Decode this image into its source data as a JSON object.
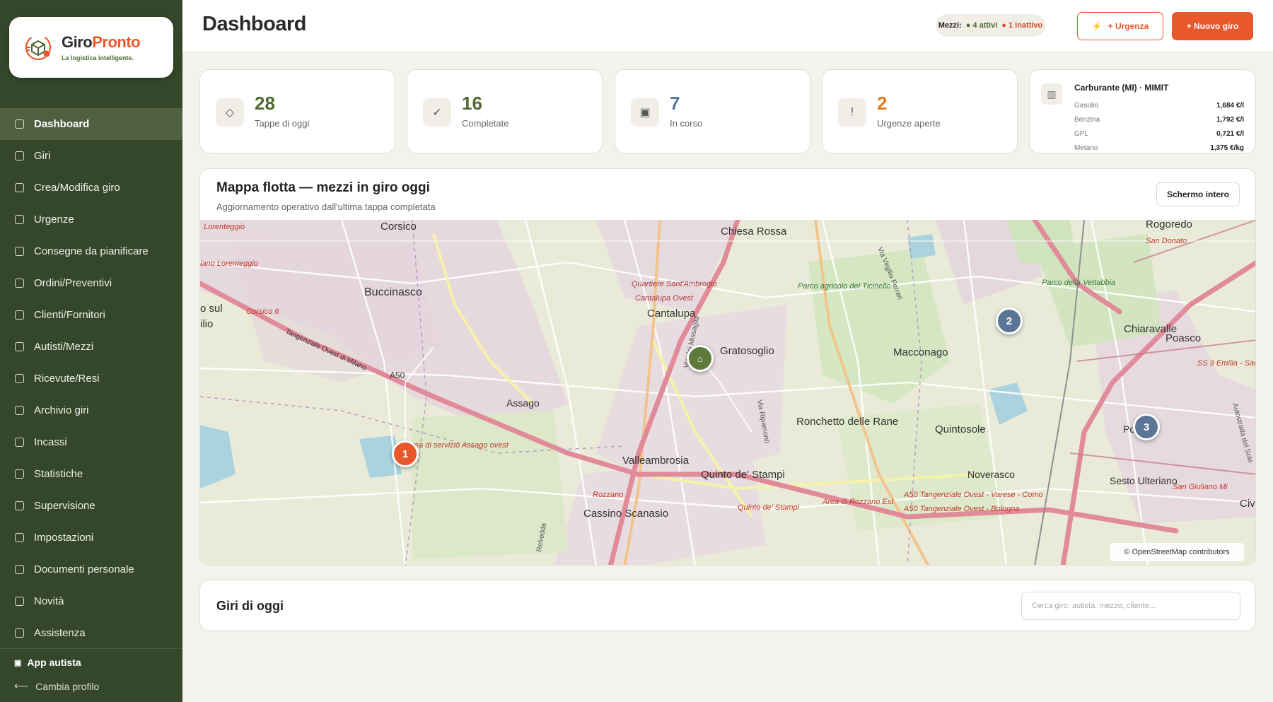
{
  "brand": {
    "name_part1": "Giro",
    "name_part2": "Pronto",
    "tagline": "La logistica intelligente."
  },
  "sidebar": {
    "items": [
      {
        "label": "Dashboard",
        "active": true
      },
      {
        "label": "Giri"
      },
      {
        "label": "Crea/Modifica giro"
      },
      {
        "label": "Urgenze"
      },
      {
        "label": "Consegne da pianificare"
      },
      {
        "label": "Ordini/Preventivi"
      },
      {
        "label": "Clienti/Fornitori"
      },
      {
        "label": "Autisti/Mezzi"
      },
      {
        "label": "Ricevute/Resi"
      },
      {
        "label": "Archivio giri"
      },
      {
        "label": "Incassi"
      },
      {
        "label": "Statistiche"
      },
      {
        "label": "Supervisione"
      },
      {
        "label": "Impostazioni"
      },
      {
        "label": "Documenti personale"
      },
      {
        "label": "Novità"
      },
      {
        "label": "Assistenza"
      }
    ],
    "app_driver": "App autista",
    "change_profile": "Cambia profilo"
  },
  "header": {
    "title": "Dashboard",
    "fleet_label": "Mezzi:",
    "fleet_active": "● 4 attivi",
    "fleet_inactive": "● 1 inattivo",
    "urgency_button": "+ Urgenza",
    "new_tour_button": "+ Nuovo giro"
  },
  "stats": [
    {
      "value": "28",
      "label": "Tappe di oggi",
      "icon": "◇",
      "color": "#4f6a31"
    },
    {
      "value": "16",
      "label": "Completate",
      "icon": "✓",
      "color": "#4f6a31"
    },
    {
      "value": "7",
      "label": "In corso",
      "icon": "▣",
      "color": "#5b78a0"
    },
    {
      "value": "2",
      "label": "Urgenze aperte",
      "icon": "!",
      "color": "#e07b1e"
    }
  ],
  "fuel": {
    "title": "Carburante (MI) · MIMIT",
    "rows": [
      {
        "name": "Gasolio",
        "price": "1,684 €/l"
      },
      {
        "name": "Benzina",
        "price": "1,792 €/l"
      },
      {
        "name": "GPL",
        "price": "0,721 €/l"
      },
      {
        "name": "Metano",
        "price": "1,375 €/kg"
      }
    ]
  },
  "map": {
    "title": "Mappa flotta — mezzi in giro oggi",
    "subtitle": "Aggiornamento operativo dall'ultima tappa completata",
    "fullscreen_button": "Schermo intero",
    "attribution": "© OpenStreetMap contributors",
    "places": [
      "Corsico",
      "Chiesa Rossa",
      "Rogoredo",
      "San Donato",
      "Lorenteggio",
      "iano Lorenteggio",
      "Buccinasco",
      "Quartiere Sant'Ambrogio",
      "Cantalupa Ovest",
      "Cantalupa",
      "Parco agricolo del Ticinello",
      "Via Virgilio Ferrari",
      "Parco della Vettabbia",
      "o sul",
      "ilio",
      "Corsico 6",
      "Tangenziale Ovest di Milano",
      "Gratosoglio",
      "Macconago",
      "Chiaravalle",
      "Poasco",
      "SS 9 Emilia - San Do",
      "A50",
      "Assago",
      "Ronchetto delle Rane",
      "Quintosole",
      "Poasco",
      "Area di servizio Assago ovest",
      "Valleambrosia",
      "Noverasco",
      "Quinto de' Stampi",
      "Sesto Ulteriano",
      "San Giuliano Mi",
      "Rozzano",
      "Area di Rozzano Est",
      "A50 Tangenziale Ovest - Varese - Como",
      "A50 Tangenziale Ovest - Bologna",
      "Cassino Scanasio",
      "Quinto de' Stampi",
      "Civ",
      "Refredda",
      "Via dei Missaglia",
      "Via Ripamonti",
      "Autostrada del Sole"
    ],
    "markers": [
      {
        "label": "1",
        "color": "#e8582b"
      },
      {
        "label": "2",
        "color": "#5b7596"
      },
      {
        "label": "3",
        "color": "#5b7596"
      },
      {
        "label": "⌂",
        "color": "#5f7a3a"
      }
    ]
  },
  "today_tours": {
    "title": "Giri di oggi",
    "search_placeholder": "Cerca giro, autista, mezzo, cliente..."
  }
}
